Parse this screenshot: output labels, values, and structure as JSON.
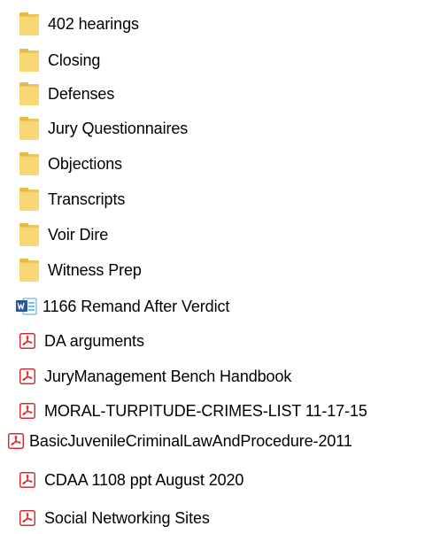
{
  "items": [
    {
      "type": "folder",
      "icon": "folder-icon",
      "label": "402 hearings"
    },
    {
      "type": "folder",
      "icon": "folder-icon",
      "label": "Closing"
    },
    {
      "type": "folder",
      "icon": "folder-icon",
      "label": "Defenses"
    },
    {
      "type": "folder",
      "icon": "folder-icon",
      "label": "Jury Questionnaires"
    },
    {
      "type": "folder",
      "icon": "folder-icon",
      "label": "Objections"
    },
    {
      "type": "folder",
      "icon": "folder-icon",
      "label": "Transcripts"
    },
    {
      "type": "folder",
      "icon": "folder-icon",
      "label": "Voir Dire"
    },
    {
      "type": "folder",
      "icon": "folder-icon",
      "label": "Witness Prep"
    },
    {
      "type": "word",
      "icon": "word-doc-icon",
      "label": "1166 Remand After Verdict"
    },
    {
      "type": "pdf",
      "icon": "pdf-icon",
      "label": "DA arguments"
    },
    {
      "type": "pdf",
      "icon": "pdf-icon",
      "label": "JuryManagement Bench Handbook"
    },
    {
      "type": "pdf",
      "icon": "pdf-icon",
      "label": "MORAL-TURPITUDE-CRIMES-LIST 11-17-15"
    },
    {
      "type": "pdf",
      "icon": "pdf-icon",
      "label": "BasicJuvenileCriminalLawAndProcedure-2011"
    },
    {
      "type": "pdf",
      "icon": "pdf-icon",
      "label": "CDAA 1108 ppt August 2020"
    },
    {
      "type": "pdf",
      "icon": "pdf-icon",
      "label": "Social Networking Sites"
    }
  ],
  "colors": {
    "folder": "#f8d775",
    "folder_tab": "#e8b84a",
    "pdf_red": "#d32f2f",
    "word_blue": "#2b579a"
  }
}
